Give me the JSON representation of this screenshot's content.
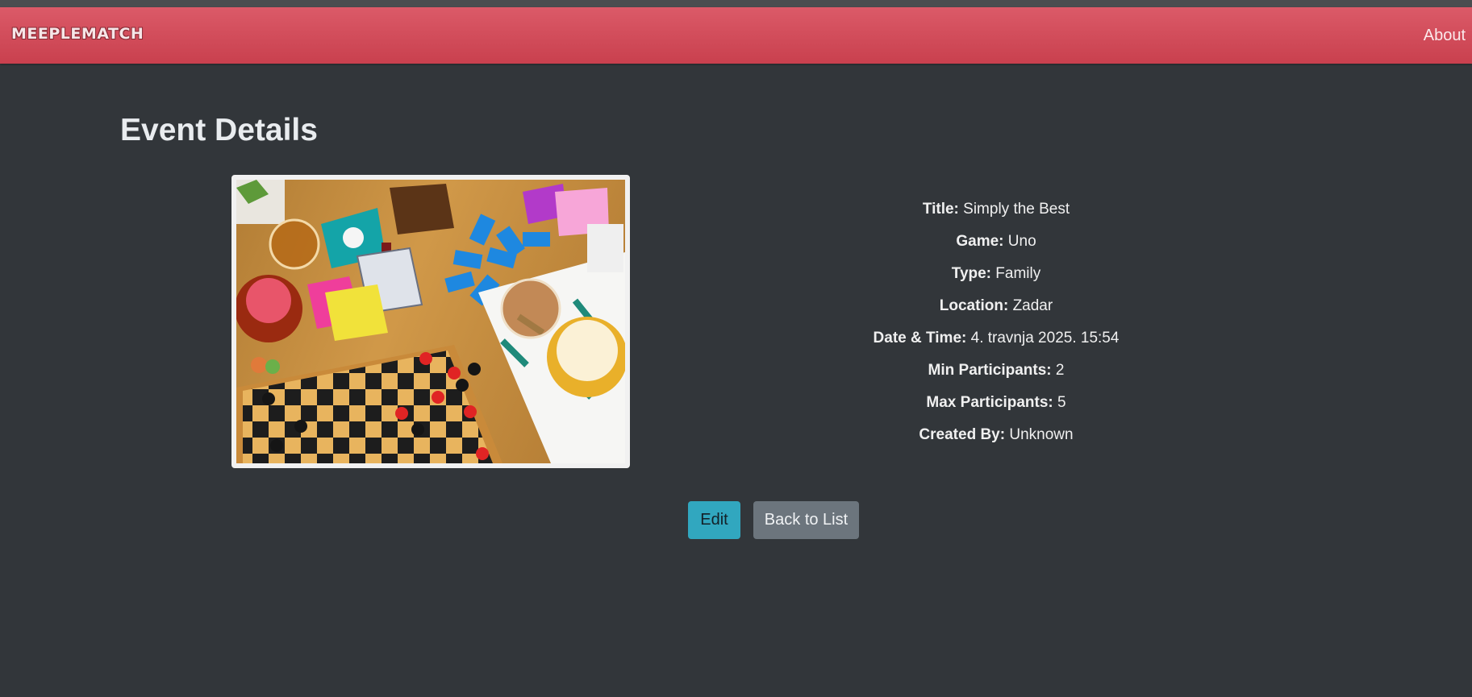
{
  "navbar": {
    "brand": "MEEPLEMATCH",
    "about_label": "About"
  },
  "page": {
    "title": "Event Details"
  },
  "event": {
    "image_alt": "Board games on a table",
    "fields": [
      {
        "label": "Title:",
        "value": "Simply the Best"
      },
      {
        "label": "Game:",
        "value": "Uno"
      },
      {
        "label": "Type:",
        "value": "Family"
      },
      {
        "label": "Location:",
        "value": "Zadar"
      },
      {
        "label": "Date & Time:",
        "value": "4. travnja 2025. 15:54"
      },
      {
        "label": "Min Participants:",
        "value": "2"
      },
      {
        "label": "Max Participants:",
        "value": "5"
      },
      {
        "label": "Created By:",
        "value": "Unknown"
      }
    ]
  },
  "actions": {
    "edit_label": "Edit",
    "back_label": "Back to List"
  },
  "colors": {
    "navbar": "#d14b59",
    "background": "#32363a",
    "edit_button": "#31a7bf",
    "back_button": "#6c757d"
  }
}
